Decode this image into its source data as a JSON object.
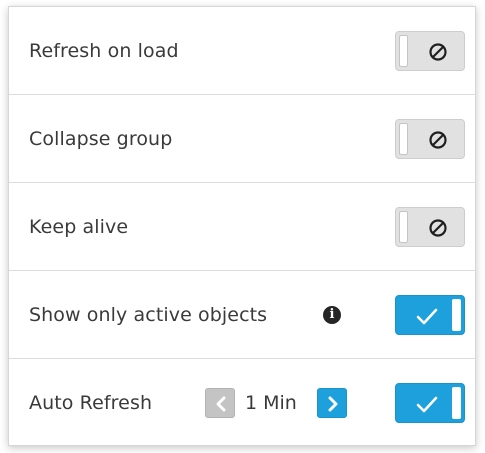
{
  "settings": {
    "rows": [
      {
        "label": "Refresh on load",
        "toggle_state": "off"
      },
      {
        "label": "Collapse group",
        "toggle_state": "off"
      },
      {
        "label": "Keep alive",
        "toggle_state": "off"
      },
      {
        "label": "Show only active objects",
        "toggle_state": "on",
        "info_icon": "info-icon"
      },
      {
        "label": "Auto Refresh",
        "toggle_state": "on"
      }
    ],
    "auto_refresh": {
      "interval_value": "1",
      "interval_unit": "Min",
      "interval_text": "1 Min"
    }
  },
  "icons": {
    "off_glyph": "disabled-circle-icon",
    "on_glyph": "checkmark-icon",
    "prev": "chevron-left-icon",
    "next": "chevron-right-icon",
    "info": "info-icon"
  },
  "colors": {
    "accent": "#1ea0dc",
    "toggle_off_bg": "#e1e1e1",
    "prev_disabled_bg": "#c4c4c4",
    "text": "#3a3a3a"
  }
}
